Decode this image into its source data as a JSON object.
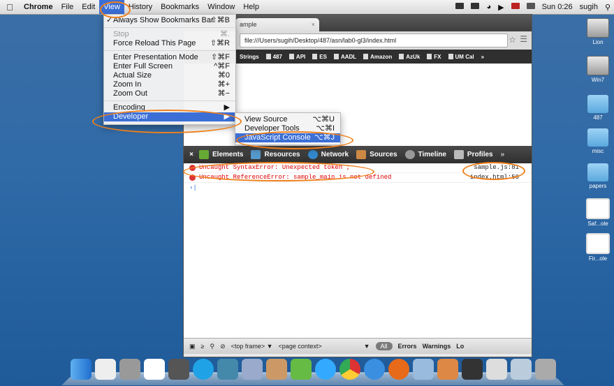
{
  "menubar": {
    "app": "Chrome",
    "items": [
      "File",
      "Edit",
      "View",
      "History",
      "Bookmarks",
      "Window",
      "Help"
    ],
    "clock": "Sun 0:26",
    "user": "sugih"
  },
  "view_menu": {
    "items": [
      {
        "label": "Always Show Bookmarks Bar",
        "shortcut": "⇧⌘B",
        "checked": "✓"
      },
      {
        "label": "Stop",
        "shortcut": "⌘.",
        "disabled": true
      },
      {
        "label": "Force Reload This Page",
        "shortcut": "⇧⌘R"
      },
      {
        "label": "Enter Presentation Mode",
        "shortcut": "⇧⌘F"
      },
      {
        "label": "Enter Full Screen",
        "shortcut": "^⌘F"
      },
      {
        "label": "Actual Size",
        "shortcut": "⌘0"
      },
      {
        "label": "Zoom In",
        "shortcut": "⌘+"
      },
      {
        "label": "Zoom Out",
        "shortcut": "⌘−"
      },
      {
        "label": "Encoding",
        "shortcut": "▶"
      },
      {
        "label": "Developer",
        "shortcut": "▶"
      }
    ]
  },
  "developer_menu": {
    "items": [
      {
        "label": "View Source",
        "shortcut": "⌥⌘U"
      },
      {
        "label": "Developer Tools",
        "shortcut": "⌥⌘I"
      },
      {
        "label": "JavaScript Console",
        "shortcut": "⌥⌘J"
      }
    ]
  },
  "browser": {
    "tab_title": "ample",
    "url": "file:///Users/sugih/Desktop/487/asn/lab0-gl3/index.html",
    "bookmarks": [
      "Strings",
      "487",
      "API",
      "ES",
      "AADL",
      "Amazon",
      "AzUk",
      "FX",
      "UM Cal"
    ],
    "bookmarks_more": "»"
  },
  "devtools": {
    "panels": [
      "Elements",
      "Resources",
      "Network",
      "Sources",
      "Timeline",
      "Profiles"
    ],
    "more": "»",
    "close": "×",
    "messages": [
      {
        "text": "Uncaught SyntaxError: Unexpected token ;",
        "source": "sample.js:81"
      },
      {
        "text": "Uncaught ReferenceError: sample_main is not defined",
        "source": "index.html:50"
      }
    ],
    "prompt": "›|",
    "bottom": {
      "frame": "<top frame> ▼",
      "context": "<page context>",
      "filter_all": "All",
      "filters": [
        "Errors",
        "Warnings",
        "Lo"
      ]
    }
  },
  "desktop_icons": [
    "Lion",
    "Win7",
    "487",
    "misc",
    "papers",
    "Saf...ole",
    "Fir...ole"
  ]
}
